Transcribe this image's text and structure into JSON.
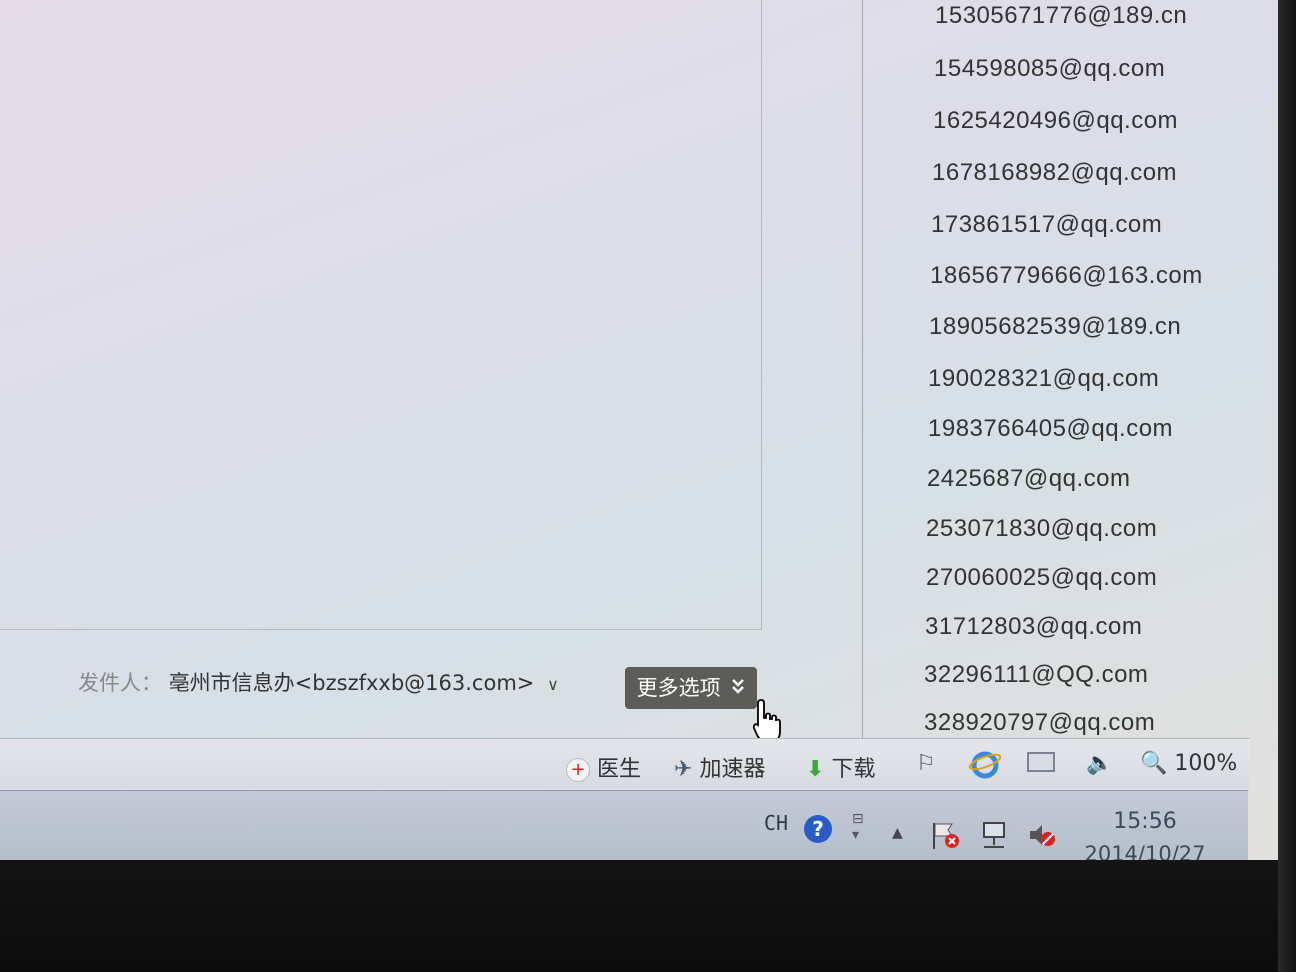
{
  "contacts": [
    "15305671776@189.cn",
    "154598085@qq.com",
    "1625420496@qq.com",
    "1678168982@qq.com",
    "173861517@qq.com",
    "18656779666@163.com",
    "18905682539@189.cn",
    "190028321@qq.com",
    "1983766405@qq.com",
    "2425687@qq.com",
    "253071830@qq.com",
    "270060025@qq.com",
    "31712803@qq.com",
    "32296111@QQ.com",
    "328920797@qq.com"
  ],
  "sender": {
    "label": "发件人：",
    "value": "亳州市信息办<bzszfxxb@163.com>",
    "caret": "∨"
  },
  "more_options": {
    "label": "更多选项",
    "icon": "double-chevron-down-icon"
  },
  "statusbar": {
    "doctor": "医生",
    "accelerator": "加速器",
    "download": "下载",
    "zoom": "100%"
  },
  "taskbar": {
    "language": "CH",
    "time": "15:56",
    "date": "2014/10/27"
  }
}
